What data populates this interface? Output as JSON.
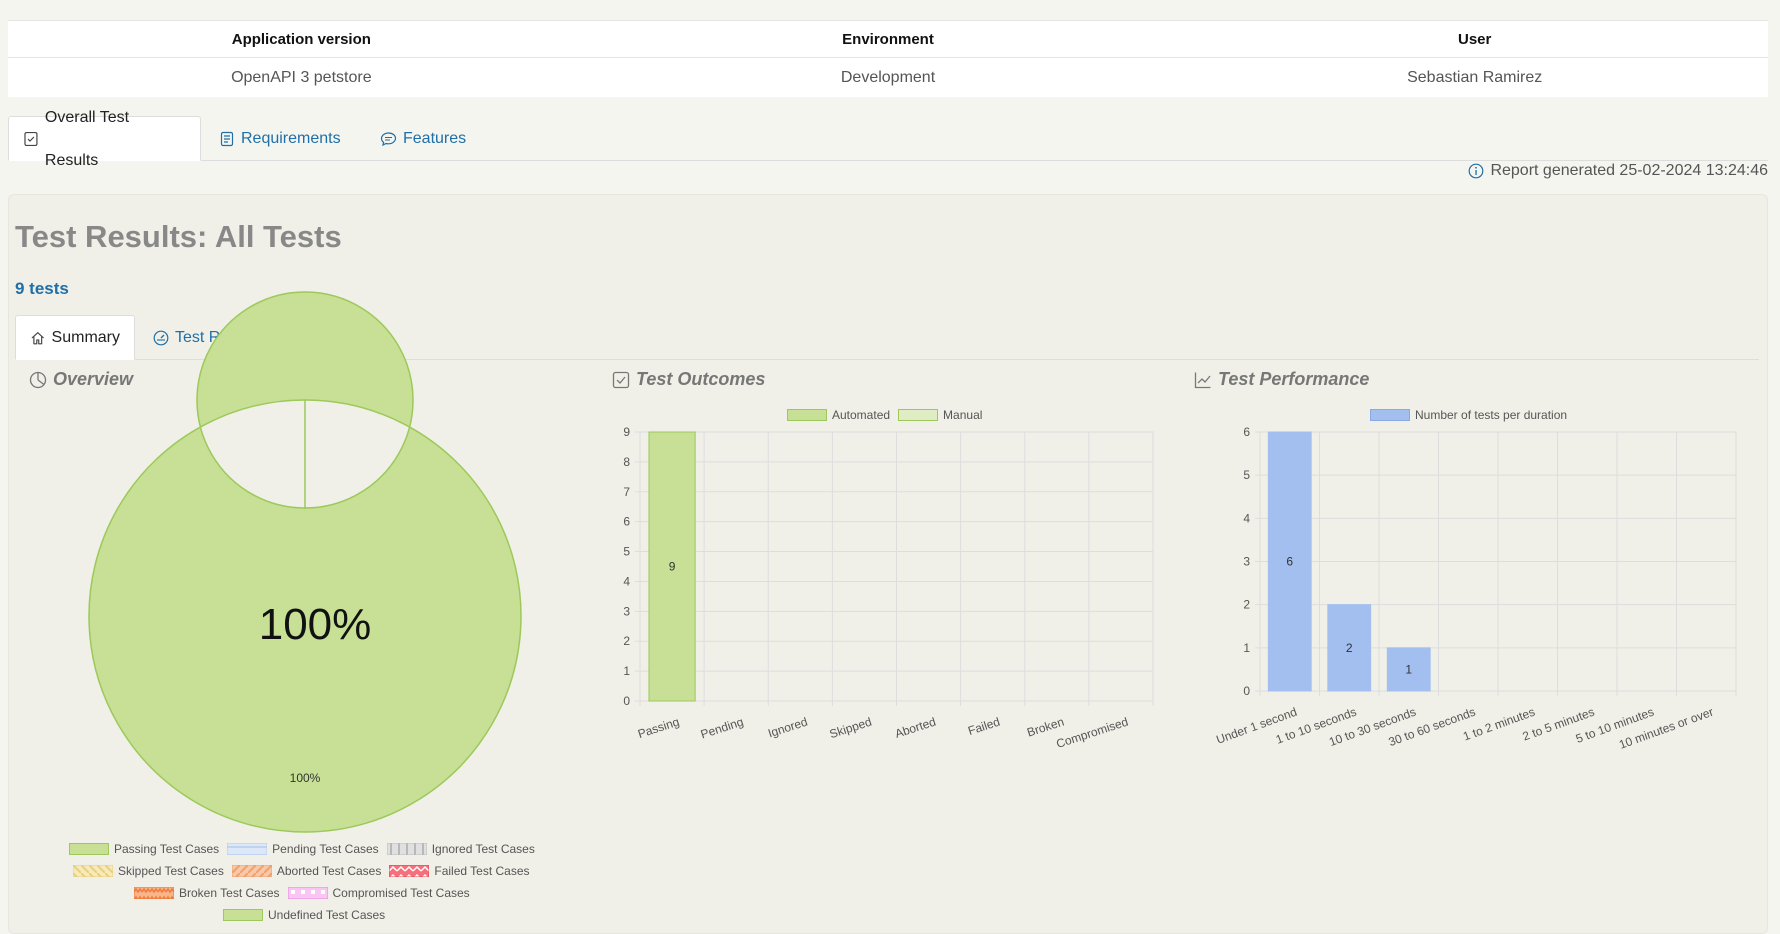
{
  "info": {
    "headers": [
      "Application version",
      "Environment",
      "User"
    ],
    "values": [
      "OpenAPI 3 petstore",
      "Development",
      "Sebastian Ramirez"
    ]
  },
  "tabs": {
    "overall": "Overall Test Results",
    "requirements": "Requirements",
    "features": "Features"
  },
  "report_generated": "Report generated 25-02-2024 13:24:46",
  "panel": {
    "title": "Test Results: All Tests",
    "tests_count": "9 tests",
    "sub_tabs": {
      "summary": "Summary",
      "test_results": "Test Results"
    }
  },
  "sections": {
    "overview": "Overview",
    "outcomes": "Test Outcomes",
    "performance": "Test Performance"
  },
  "colors": {
    "passing": "#c7e095",
    "passing_border": "#9cc95a",
    "bar_blue": "#a3bff0",
    "link": "#1f6fa8"
  },
  "chart_data": [
    {
      "type": "pie",
      "title": "Overview",
      "center_label": "100%",
      "slices": [
        {
          "label": "Passing Test Cases",
          "value": 100,
          "data_label": "100%"
        }
      ],
      "legend": [
        "Passing Test Cases",
        "Pending Test Cases",
        "Ignored Test Cases",
        "Skipped Test Cases",
        "Aborted Test Cases",
        "Failed Test Cases",
        "Broken Test Cases",
        "Compromised Test Cases",
        "Undefined Test Cases"
      ]
    },
    {
      "type": "bar",
      "title": "Test Outcomes",
      "categories": [
        "Passing",
        "Pending",
        "Ignored",
        "Skipped",
        "Aborted",
        "Failed",
        "Broken",
        "Compromised"
      ],
      "series": [
        {
          "name": "Automated",
          "values": [
            9,
            0,
            0,
            0,
            0,
            0,
            0,
            0
          ]
        },
        {
          "name": "Manual",
          "values": [
            0,
            0,
            0,
            0,
            0,
            0,
            0,
            0
          ]
        }
      ],
      "ylim": [
        0,
        9
      ],
      "yticks": [
        0,
        1,
        2,
        3,
        4,
        5,
        6,
        7,
        8,
        9
      ]
    },
    {
      "type": "bar",
      "title": "Test Performance",
      "categories": [
        "Under 1 second",
        "1 to 10 seconds",
        "10 to 30 seconds",
        "30 to 60 seconds",
        "1 to 2 minutes",
        "2 to 5 minutes",
        "5 to 10 minutes",
        "10 minutes or over"
      ],
      "series": [
        {
          "name": "Number of tests per duration",
          "values": [
            6,
            2,
            1,
            0,
            0,
            0,
            0,
            0
          ]
        }
      ],
      "ylim": [
        0,
        6
      ],
      "yticks": [
        0,
        1,
        2,
        3,
        4,
        5,
        6
      ]
    }
  ]
}
